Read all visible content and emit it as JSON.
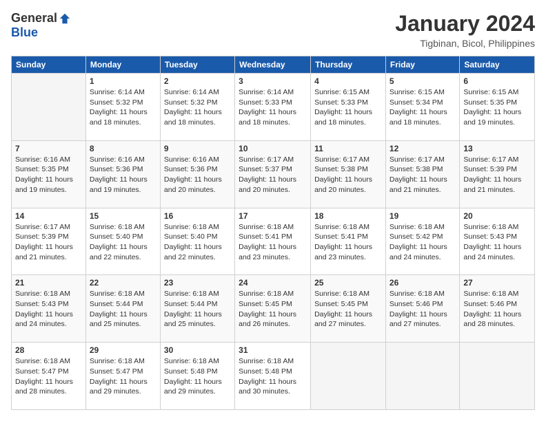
{
  "logo": {
    "general": "General",
    "blue": "Blue"
  },
  "title": "January 2024",
  "location": "Tigbinan, Bicol, Philippines",
  "days_header": [
    "Sunday",
    "Monday",
    "Tuesday",
    "Wednesday",
    "Thursday",
    "Friday",
    "Saturday"
  ],
  "weeks": [
    [
      {
        "num": "",
        "info": ""
      },
      {
        "num": "1",
        "info": "Sunrise: 6:14 AM\nSunset: 5:32 PM\nDaylight: 11 hours\nand 18 minutes."
      },
      {
        "num": "2",
        "info": "Sunrise: 6:14 AM\nSunset: 5:32 PM\nDaylight: 11 hours\nand 18 minutes."
      },
      {
        "num": "3",
        "info": "Sunrise: 6:14 AM\nSunset: 5:33 PM\nDaylight: 11 hours\nand 18 minutes."
      },
      {
        "num": "4",
        "info": "Sunrise: 6:15 AM\nSunset: 5:33 PM\nDaylight: 11 hours\nand 18 minutes."
      },
      {
        "num": "5",
        "info": "Sunrise: 6:15 AM\nSunset: 5:34 PM\nDaylight: 11 hours\nand 18 minutes."
      },
      {
        "num": "6",
        "info": "Sunrise: 6:15 AM\nSunset: 5:35 PM\nDaylight: 11 hours\nand 19 minutes."
      }
    ],
    [
      {
        "num": "7",
        "info": "Sunrise: 6:16 AM\nSunset: 5:35 PM\nDaylight: 11 hours\nand 19 minutes."
      },
      {
        "num": "8",
        "info": "Sunrise: 6:16 AM\nSunset: 5:36 PM\nDaylight: 11 hours\nand 19 minutes."
      },
      {
        "num": "9",
        "info": "Sunrise: 6:16 AM\nSunset: 5:36 PM\nDaylight: 11 hours\nand 20 minutes."
      },
      {
        "num": "10",
        "info": "Sunrise: 6:17 AM\nSunset: 5:37 PM\nDaylight: 11 hours\nand 20 minutes."
      },
      {
        "num": "11",
        "info": "Sunrise: 6:17 AM\nSunset: 5:38 PM\nDaylight: 11 hours\nand 20 minutes."
      },
      {
        "num": "12",
        "info": "Sunrise: 6:17 AM\nSunset: 5:38 PM\nDaylight: 11 hours\nand 21 minutes."
      },
      {
        "num": "13",
        "info": "Sunrise: 6:17 AM\nSunset: 5:39 PM\nDaylight: 11 hours\nand 21 minutes."
      }
    ],
    [
      {
        "num": "14",
        "info": "Sunrise: 6:17 AM\nSunset: 5:39 PM\nDaylight: 11 hours\nand 21 minutes."
      },
      {
        "num": "15",
        "info": "Sunrise: 6:18 AM\nSunset: 5:40 PM\nDaylight: 11 hours\nand 22 minutes."
      },
      {
        "num": "16",
        "info": "Sunrise: 6:18 AM\nSunset: 5:40 PM\nDaylight: 11 hours\nand 22 minutes."
      },
      {
        "num": "17",
        "info": "Sunrise: 6:18 AM\nSunset: 5:41 PM\nDaylight: 11 hours\nand 23 minutes."
      },
      {
        "num": "18",
        "info": "Sunrise: 6:18 AM\nSunset: 5:41 PM\nDaylight: 11 hours\nand 23 minutes."
      },
      {
        "num": "19",
        "info": "Sunrise: 6:18 AM\nSunset: 5:42 PM\nDaylight: 11 hours\nand 24 minutes."
      },
      {
        "num": "20",
        "info": "Sunrise: 6:18 AM\nSunset: 5:43 PM\nDaylight: 11 hours\nand 24 minutes."
      }
    ],
    [
      {
        "num": "21",
        "info": "Sunrise: 6:18 AM\nSunset: 5:43 PM\nDaylight: 11 hours\nand 24 minutes."
      },
      {
        "num": "22",
        "info": "Sunrise: 6:18 AM\nSunset: 5:44 PM\nDaylight: 11 hours\nand 25 minutes."
      },
      {
        "num": "23",
        "info": "Sunrise: 6:18 AM\nSunset: 5:44 PM\nDaylight: 11 hours\nand 25 minutes."
      },
      {
        "num": "24",
        "info": "Sunrise: 6:18 AM\nSunset: 5:45 PM\nDaylight: 11 hours\nand 26 minutes."
      },
      {
        "num": "25",
        "info": "Sunrise: 6:18 AM\nSunset: 5:45 PM\nDaylight: 11 hours\nand 27 minutes."
      },
      {
        "num": "26",
        "info": "Sunrise: 6:18 AM\nSunset: 5:46 PM\nDaylight: 11 hours\nand 27 minutes."
      },
      {
        "num": "27",
        "info": "Sunrise: 6:18 AM\nSunset: 5:46 PM\nDaylight: 11 hours\nand 28 minutes."
      }
    ],
    [
      {
        "num": "28",
        "info": "Sunrise: 6:18 AM\nSunset: 5:47 PM\nDaylight: 11 hours\nand 28 minutes."
      },
      {
        "num": "29",
        "info": "Sunrise: 6:18 AM\nSunset: 5:47 PM\nDaylight: 11 hours\nand 29 minutes."
      },
      {
        "num": "30",
        "info": "Sunrise: 6:18 AM\nSunset: 5:48 PM\nDaylight: 11 hours\nand 29 minutes."
      },
      {
        "num": "31",
        "info": "Sunrise: 6:18 AM\nSunset: 5:48 PM\nDaylight: 11 hours\nand 30 minutes."
      },
      {
        "num": "",
        "info": ""
      },
      {
        "num": "",
        "info": ""
      },
      {
        "num": "",
        "info": ""
      }
    ]
  ]
}
